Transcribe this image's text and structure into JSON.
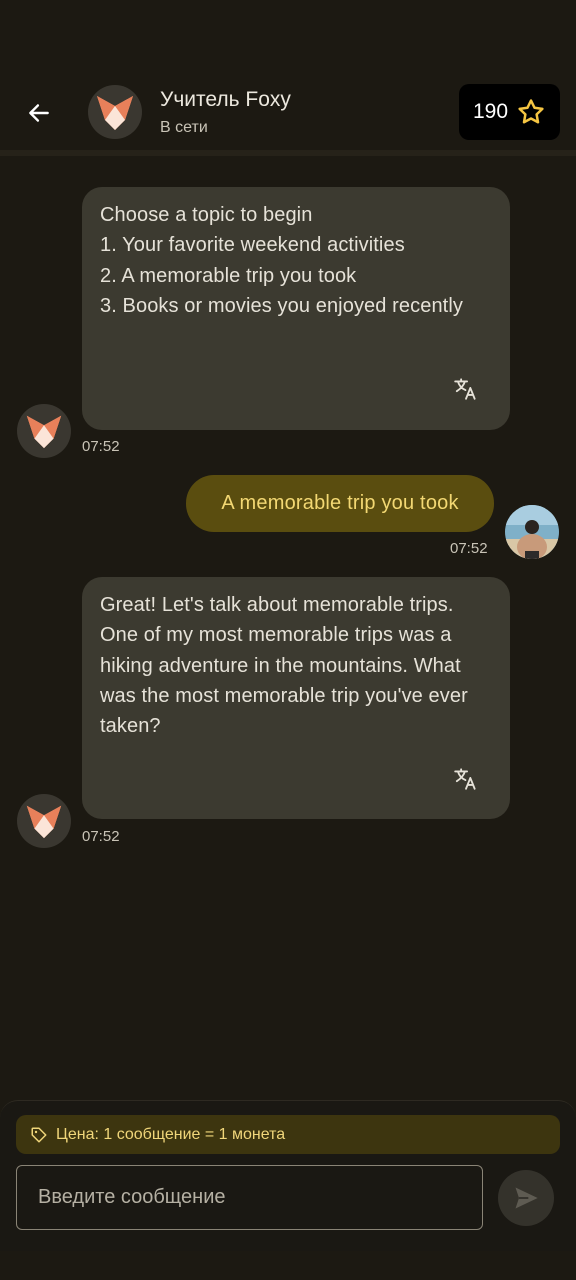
{
  "header": {
    "title": "Учитель Foxy",
    "status": "В сети",
    "coins": "190",
    "icons": {
      "back": "arrow-left-icon",
      "coin": "star-outline-icon"
    }
  },
  "messages": [
    {
      "sender": "bot",
      "text": "Choose a topic to begin\n1. Your favorite weekend activities\n2. A memorable trip you took\n3. Books or movies you enjoyed recently",
      "time": "07:52"
    },
    {
      "sender": "user",
      "text": "A memorable trip you took",
      "time": "07:52"
    },
    {
      "sender": "bot",
      "text": "Great! Let's talk about memorable trips. One of my most memorable trips was a hiking adventure in the mountains. What was the most memorable trip you've ever taken?",
      "time": "07:52"
    }
  ],
  "composer": {
    "price_label": "Цена: 1 сообщение = 1 монета",
    "placeholder": "Введите сообщение",
    "icons": {
      "price": "tag-icon",
      "send": "send-icon",
      "translate": "translate-icon"
    }
  },
  "colors": {
    "background": "#1c1912",
    "bot_bubble": "#3c3a30",
    "user_bubble": "#5a4d0f",
    "user_text": "#f3d873",
    "accent": "#f5c542"
  }
}
